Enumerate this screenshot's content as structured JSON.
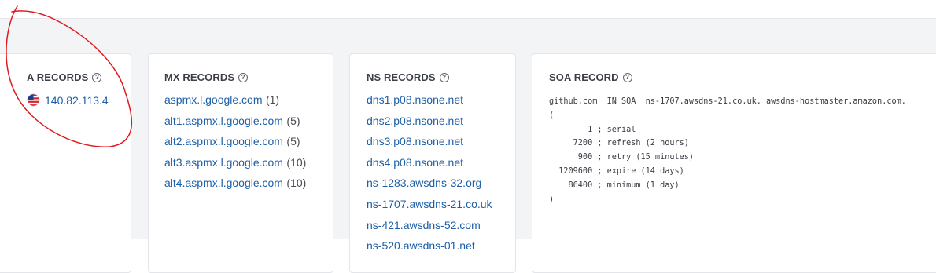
{
  "a_records": {
    "title": "A RECORDS",
    "flag_icon": "us-flag-icon",
    "ip": "140.82.113.4"
  },
  "mx_records": {
    "title": "MX RECORDS",
    "items": [
      {
        "host": "aspmx.l.google.com",
        "priority": "(1)"
      },
      {
        "host": "alt1.aspmx.l.google.com",
        "priority": "(5)"
      },
      {
        "host": "alt2.aspmx.l.google.com",
        "priority": "(5)"
      },
      {
        "host": "alt3.aspmx.l.google.com",
        "priority": "(10)"
      },
      {
        "host": "alt4.aspmx.l.google.com",
        "priority": "(10)"
      }
    ]
  },
  "ns_records": {
    "title": "NS RECORDS",
    "items": [
      "dns1.p08.nsone.net",
      "dns2.p08.nsone.net",
      "dns3.p08.nsone.net",
      "dns4.p08.nsone.net",
      "ns-1283.awsdns-32.org",
      "ns-1707.awsdns-21.co.uk",
      "ns-421.awsdns-52.com",
      "ns-520.awsdns-01.net"
    ]
  },
  "soa_record": {
    "title": "SOA RECORD",
    "lines": [
      "github.com  IN SOA  ns-1707.awsdns-21.co.uk. awsdns-hostmaster.amazon.com.",
      "(",
      "        1 ; serial",
      "     7200 ; refresh (2 hours)",
      "      900 ; retry (15 minutes)",
      "  1209600 ; expire (14 days)",
      "    86400 ; minimum (1 day)",
      ")"
    ]
  },
  "colors": {
    "link": "#1d5fa8",
    "annotation": "#e0191f",
    "background": "#f3f4f6"
  }
}
